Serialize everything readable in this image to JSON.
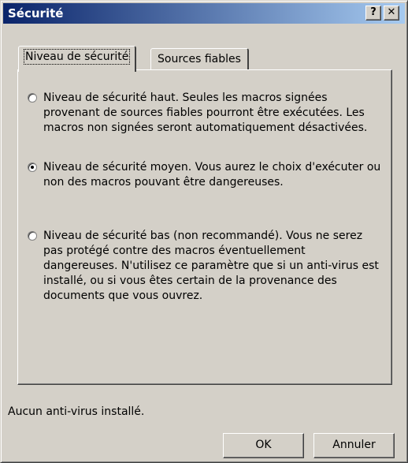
{
  "window": {
    "title": "Sécurité",
    "help_glyph": "?",
    "close_glyph": "✕"
  },
  "tabs": [
    {
      "label": "Niveau de sécurité",
      "active": true
    },
    {
      "label": "Sources fiables",
      "active": false
    }
  ],
  "options": [
    {
      "selected": false,
      "text": "Niveau de sécurité haut. Seules les macros signées provenant de sources fiables pourront être exécutées. Les macros non signées seront automatiquement désactivées."
    },
    {
      "selected": true,
      "text": "Niveau de sécurité moyen. Vous aurez le choix d'exécuter ou non des macros pouvant être dangereuses."
    },
    {
      "selected": false,
      "text": "Niveau de sécurité bas (non recommandé). Vous ne serez pas protégé contre des macros éventuellement dangereuses. N'utilisez ce paramètre que si un anti-virus est installé, ou si vous êtes certain de la provenance des documents que vous ouvrez."
    }
  ],
  "status_text": "Aucun anti-virus installé.",
  "buttons": {
    "ok": "OK",
    "cancel": "Annuler"
  }
}
